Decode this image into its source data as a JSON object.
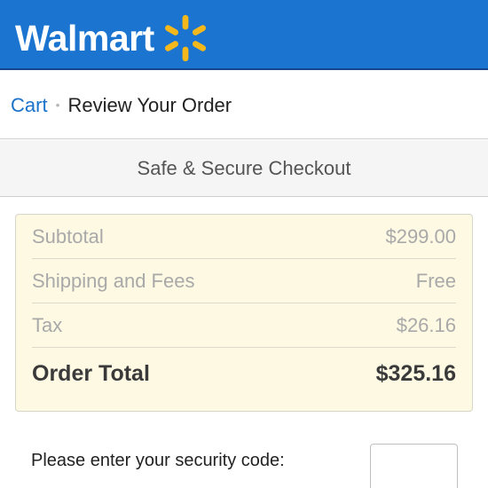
{
  "header": {
    "brand": "Walmart",
    "brand_color": "#1b75d0",
    "spark_color": "#f4b81c",
    "spark_icon": "walmart-spark-icon"
  },
  "breadcrumb": {
    "cart_label": "Cart",
    "separator": "•",
    "current_label": "Review Your Order"
  },
  "banner": {
    "label": "Safe & Secure Checkout"
  },
  "order_summary": {
    "rows": [
      {
        "label": "Subtotal",
        "value": "$299.00"
      },
      {
        "label": "Shipping and Fees",
        "value": "Free"
      },
      {
        "label": "Tax",
        "value": "$26.16"
      }
    ],
    "total": {
      "label": "Order Total",
      "value": "$325.16"
    }
  },
  "security": {
    "prompt": "Please enter your security code:",
    "value": ""
  }
}
